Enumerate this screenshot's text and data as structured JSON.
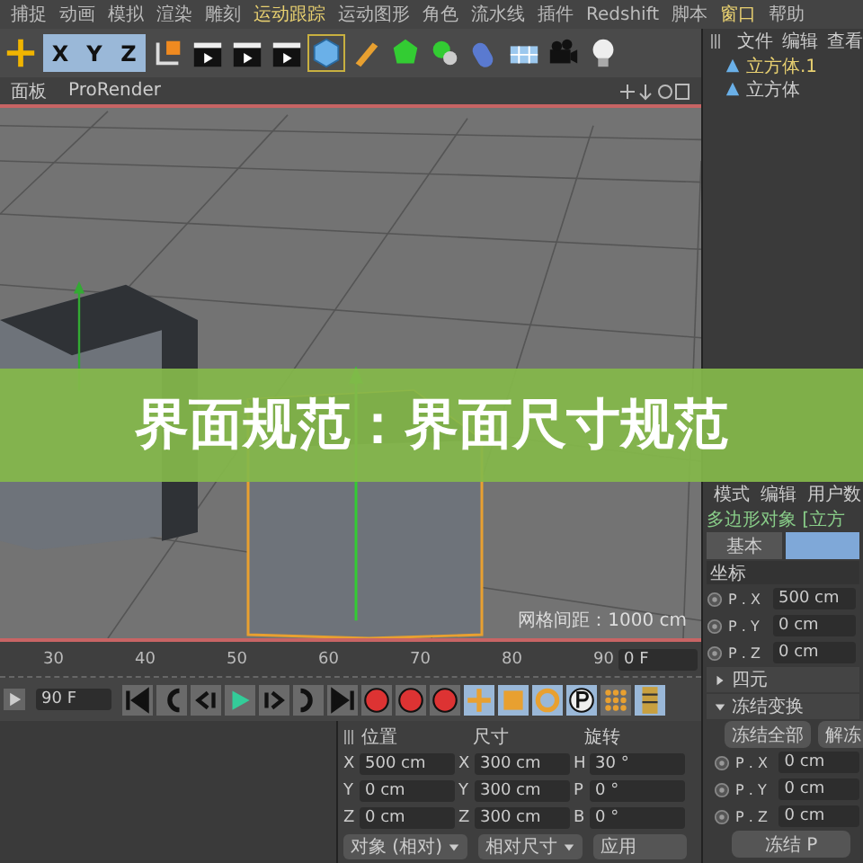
{
  "menu": [
    {
      "label": "捕捉",
      "highlighted": false
    },
    {
      "label": "动画",
      "highlighted": false
    },
    {
      "label": "模拟",
      "highlighted": false
    },
    {
      "label": "渲染",
      "highlighted": false
    },
    {
      "label": "雕刻",
      "highlighted": false
    },
    {
      "label": "运动跟踪",
      "highlighted": true
    },
    {
      "label": "运动图形",
      "highlighted": false
    },
    {
      "label": "角色",
      "highlighted": false
    },
    {
      "label": "流水线",
      "highlighted": false
    },
    {
      "label": "插件",
      "highlighted": false
    },
    {
      "label": "Redshift",
      "highlighted": false
    },
    {
      "label": "脚本",
      "highlighted": false
    },
    {
      "label": "窗口",
      "highlighted": true
    },
    {
      "label": "帮助",
      "highlighted": false
    }
  ],
  "axis_buttons": [
    {
      "label": "X",
      "selected": true
    },
    {
      "label": "Y",
      "selected": true
    },
    {
      "label": "Z",
      "selected": true
    }
  ],
  "viewport_menu": [
    "面板",
    "ProRender"
  ],
  "grid_spacing": "网格间距：1000 cm",
  "object_manager": {
    "menu": [
      "文件",
      "编辑",
      "查看"
    ],
    "objects": [
      {
        "name": "立方体.1",
        "selected": true
      },
      {
        "name": "立方体",
        "selected": false
      }
    ]
  },
  "banner": "界面规范：界面尺寸规范",
  "timeline": {
    "ticks": [
      "30",
      "40",
      "50",
      "60",
      "70",
      "80",
      "90"
    ],
    "current_frame": "0 F"
  },
  "transport": {
    "end_frame": "90 F"
  },
  "coordinates": {
    "headers": [
      "位置",
      "尺寸",
      "旋转"
    ],
    "rows": [
      {
        "position_axis": "X",
        "position": "500 cm",
        "size_axis": "X",
        "size": "300 cm",
        "rotation_axis": "H",
        "rotation": "30 °"
      },
      {
        "position_axis": "Y",
        "position": "0 cm",
        "size_axis": "Y",
        "size": "300 cm",
        "rotation_axis": "P",
        "rotation": "0 °"
      },
      {
        "position_axis": "Z",
        "position": "0 cm",
        "size_axis": "Z",
        "size": "300 cm",
        "rotation_axis": "B",
        "rotation": "0 °"
      }
    ],
    "mode": "对象 (相对)",
    "size_mode": "相对尺寸",
    "apply": "应用"
  },
  "attributes": {
    "menu": [
      "模式",
      "编辑",
      "用户数"
    ],
    "title": "多边形对象 [立方",
    "tabs": [
      {
        "label": "基本",
        "selected": false
      },
      {
        "selected": true
      }
    ],
    "section": "坐标",
    "coords": [
      {
        "label": "P . X",
        "value": "500 cm"
      },
      {
        "label": "P . Y",
        "value": "0 cm"
      },
      {
        "label": "P . Z",
        "value": "0 cm"
      }
    ],
    "groups": [
      {
        "label": "四元",
        "expanded": false
      },
      {
        "label": "冻结变换",
        "expanded": true
      }
    ],
    "freeze_buttons": [
      "冻结全部",
      "解冻"
    ],
    "frozen": [
      {
        "label": "P . X",
        "value": "0 cm"
      },
      {
        "label": "P . Y",
        "value": "0 cm"
      },
      {
        "label": "P . Z",
        "value": "0 cm"
      }
    ],
    "freeze_p": "冻结 P"
  }
}
